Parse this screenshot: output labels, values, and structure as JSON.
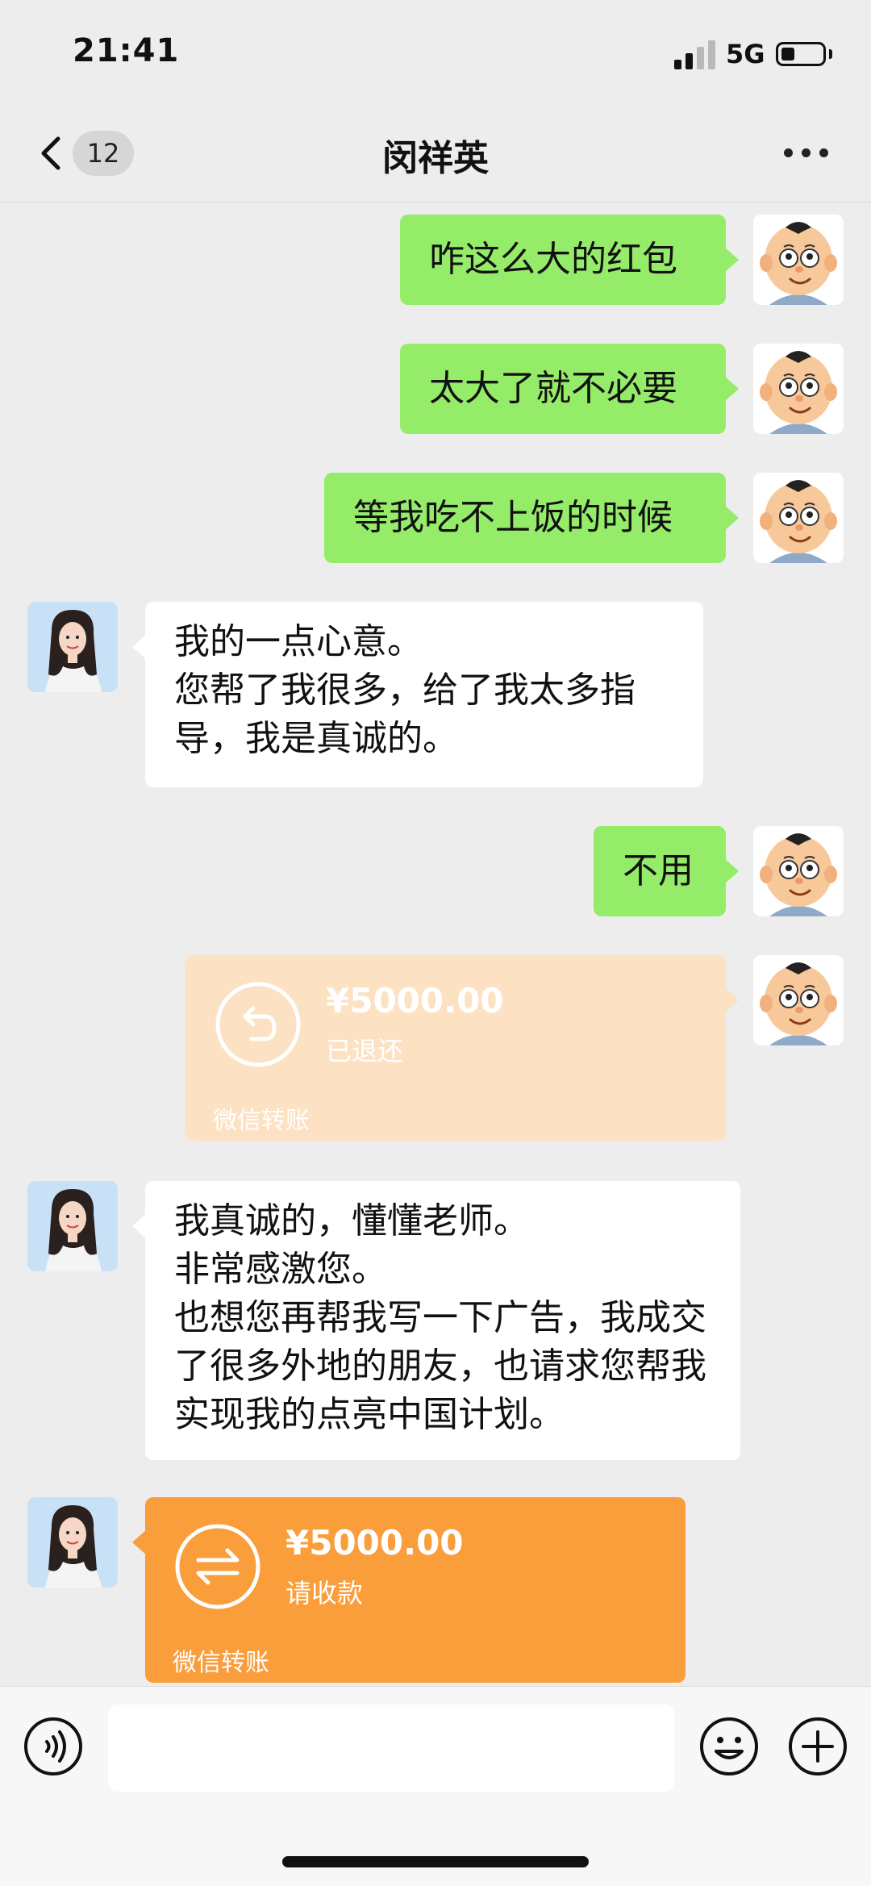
{
  "status_bar": {
    "time": "21:41",
    "network": "5G",
    "battery_fraction": 0.25
  },
  "nav": {
    "unread_count": "12",
    "title": "闵祥英",
    "back_icon": "chevron-left-icon",
    "more_icon": "more-dots-icon"
  },
  "messages": [
    {
      "side": "right",
      "type": "text",
      "text": "咋这么大的红包"
    },
    {
      "side": "right",
      "type": "text",
      "text": "太大了就不必要"
    },
    {
      "side": "right",
      "type": "text",
      "text": "等我吃不上饭的时候"
    },
    {
      "side": "left",
      "type": "text",
      "text": "我的一点心意。\n您帮了我很多，给了我太多指导，我是真诚的。"
    },
    {
      "side": "right",
      "type": "text",
      "text": "不用"
    },
    {
      "side": "right",
      "type": "transfer",
      "amount": "¥5000.00",
      "status": "已退还",
      "footer": "微信转账",
      "icon": "return-arrow-icon"
    },
    {
      "side": "left",
      "type": "text",
      "text": "我真诚的，懂懂老师。\n非常感激您。\n也想您再帮我写一下广告，我成交了很多外地的朋友，也请求您帮我实现我的点亮中国计划。"
    },
    {
      "side": "left",
      "type": "transfer",
      "amount": "¥5000.00",
      "status": "请收款",
      "footer": "微信转账",
      "icon": "transfer-arrows-icon"
    }
  ],
  "input_bar": {
    "placeholder": "",
    "voice_icon": "voice-icon",
    "emoji_icon": "emoji-icon",
    "plus_icon": "plus-icon"
  },
  "colors": {
    "background": "#ededed",
    "sent_bubble": "#95ec69",
    "received_bubble": "#ffffff",
    "transfer_pending": "#fa9d3b",
    "transfer_returned": "#fde1c3"
  }
}
